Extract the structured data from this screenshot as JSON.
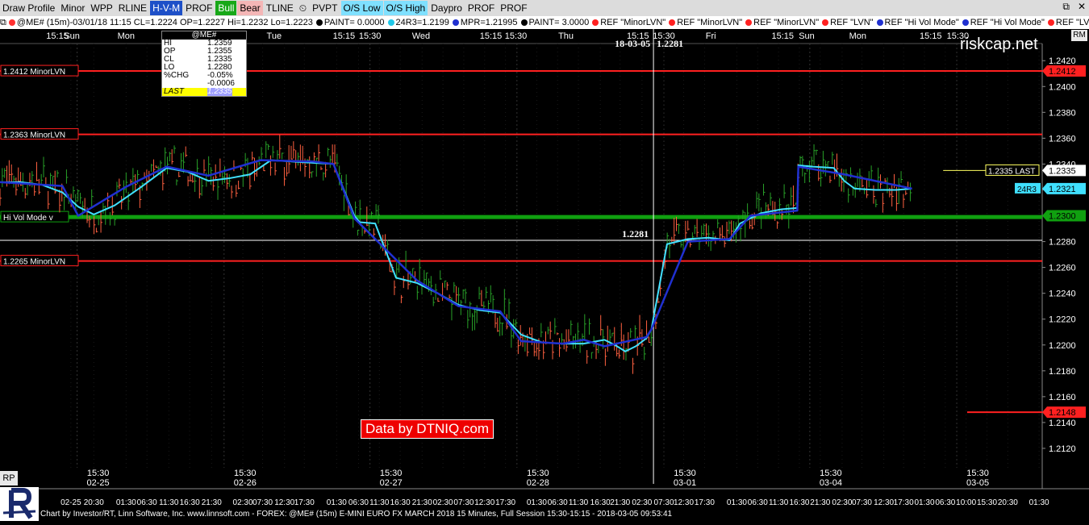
{
  "toolbar": {
    "buttons": [
      {
        "label": "Draw Profile",
        "style": ""
      },
      {
        "label": "Minor",
        "style": ""
      },
      {
        "label": "WPP",
        "style": ""
      },
      {
        "label": "RLINE",
        "style": ""
      },
      {
        "label": "H-V-M",
        "style": "blue"
      },
      {
        "label": "PROF",
        "style": ""
      },
      {
        "label": "Bull",
        "style": "green"
      },
      {
        "label": "Bear",
        "style": "pink"
      },
      {
        "label": "TLINE",
        "style": ""
      },
      {
        "label": "⏲",
        "style": ""
      },
      {
        "label": "PVPT",
        "style": ""
      },
      {
        "label": "O/S Low",
        "style": "cyan"
      },
      {
        "label": "O/S High",
        "style": "cyan"
      },
      {
        "label": "Daypro",
        "style": ""
      },
      {
        "label": "PROF",
        "style": ""
      },
      {
        "label": "PROF",
        "style": ""
      }
    ]
  },
  "window_controls": {
    "restore": "⧉",
    "close": "✕"
  },
  "study_bar": [
    {
      "text": "@ME# (15m)-03/01/18 11:15 CL=1.2224 OP=1.2227 Hi=1.2232 Lo=1.2223",
      "color": "#ff3030"
    },
    {
      "text": "PAINT= 0.0000",
      "color": "#000000"
    },
    {
      "text": "24R3=1.2199",
      "color": "#20c8e8"
    },
    {
      "text": "MPR=1.21995",
      "color": "#2030d0"
    },
    {
      "text": "PAINT= 3.0000",
      "color": "#000000"
    },
    {
      "text": "REF \"MinorLVN\"",
      "color": "#ff2020"
    },
    {
      "text": "REF \"MinorLVN\"",
      "color": "#ff2020"
    },
    {
      "text": "REF \"MinorLVN\"",
      "color": "#ff2020"
    },
    {
      "text": "REF \"LVN\"",
      "color": "#ff2020"
    },
    {
      "text": "REF \"Hi Vol Mode\"",
      "color": "#2030d0"
    },
    {
      "text": "REF \"Hi Vol Mode\"",
      "color": "#2030d0"
    },
    {
      "text": "REF \"LVN\"",
      "color": "#ff2020"
    }
  ],
  "quote": {
    "symbol": "@ME#",
    "rows": [
      {
        "label": "HI",
        "value": "1.2359"
      },
      {
        "label": "OP",
        "value": "1.2355"
      },
      {
        "label": "CL",
        "value": "1.2335"
      },
      {
        "label": "LO",
        "value": "1.2280"
      },
      {
        "label": "%CHG",
        "value": "-0.05%"
      },
      {
        "label": "",
        "value": "-0.0006"
      },
      {
        "label": "LAST",
        "value": "1.2335"
      }
    ]
  },
  "watermark": "riskcap.net",
  "data_label": "Data by DTNIQ.com",
  "footer": "Chart by Investor/RT, Linn Software, Inc. www.linnsoft.com - FOREX: @ME# (15m) E-MINI EURO FX MARCH 2018 15 Minutes, Full Session 15:30-15:15 - 2018-03-05 09:53:41",
  "rp_label": "RP",
  "rm_label": "RM",
  "chart_data": {
    "type": "line",
    "ylim": [
      1.2105,
      1.2432
    ],
    "y_ticks": [
      "1.2120",
      "1.2140",
      "1.2160",
      "1.2180",
      "1.2200",
      "1.2220",
      "1.2240",
      "1.2260",
      "1.2280",
      "1.2300",
      "1.2320",
      "1.2340",
      "1.2360",
      "1.2380",
      "1.2400",
      "1.2420"
    ],
    "top_time_labels": [
      {
        "x": 0.055,
        "t": "15:15"
      },
      {
        "x": 0.069,
        "t": "Sun"
      },
      {
        "x": 0.121,
        "t": "Mon"
      },
      {
        "x": 0.263,
        "t": "Tue"
      },
      {
        "x": 0.33,
        "t": "15:15"
      },
      {
        "x": 0.355,
        "t": "15:30"
      },
      {
        "x": 0.404,
        "t": "Wed"
      },
      {
        "x": 0.471,
        "t": "15:15"
      },
      {
        "x": 0.495,
        "t": "15:30"
      },
      {
        "x": 0.543,
        "t": "Thu"
      },
      {
        "x": 0.612,
        "t": "15:15"
      },
      {
        "x": 0.637,
        "t": "15:30"
      },
      {
        "x": 0.682,
        "t": "Fri"
      },
      {
        "x": 0.751,
        "t": "15:15"
      },
      {
        "x": 0.774,
        "t": "Sun"
      },
      {
        "x": 0.823,
        "t": "Mon"
      },
      {
        "x": 0.893,
        "t": "15:15"
      },
      {
        "x": 0.919,
        "t": "15:30"
      }
    ],
    "session_labels": [
      {
        "x": 0.074,
        "time": "15:30",
        "date": "02-25"
      },
      {
        "x": 0.215,
        "time": "15:30",
        "date": "02-26"
      },
      {
        "x": 0.355,
        "time": "15:30",
        "date": "02-27"
      },
      {
        "x": 0.496,
        "time": "15:30",
        "date": "02-28"
      },
      {
        "x": 0.637,
        "time": "15:30",
        "date": "03-01"
      },
      {
        "x": 0.777,
        "time": "15:30",
        "date": "03-04"
      },
      {
        "x": 0.918,
        "time": "15:30",
        "date": "03-05"
      }
    ],
    "bottom_time_labels": [
      {
        "x": 0.068,
        "t": "02-25"
      },
      {
        "x": 0.09,
        "t": "20:30"
      },
      {
        "x": 0.121,
        "t": "01:30"
      },
      {
        "x": 0.141,
        "t": "06:30"
      },
      {
        "x": 0.162,
        "t": "11:30"
      },
      {
        "x": 0.182,
        "t": "16:30"
      },
      {
        "x": 0.203,
        "t": "21:30"
      },
      {
        "x": 0.233,
        "t": "02:30"
      },
      {
        "x": 0.252,
        "t": "07:30"
      },
      {
        "x": 0.273,
        "t": "12:30"
      },
      {
        "x": 0.292,
        "t": "17:30"
      },
      {
        "x": 0.323,
        "t": "01:30"
      },
      {
        "x": 0.344,
        "t": "06:30"
      },
      {
        "x": 0.364,
        "t": "11:30"
      },
      {
        "x": 0.384,
        "t": "16:30"
      },
      {
        "x": 0.405,
        "t": "21:30"
      },
      {
        "x": 0.425,
        "t": "02:30"
      },
      {
        "x": 0.445,
        "t": "07:30"
      },
      {
        "x": 0.465,
        "t": "12:30"
      },
      {
        "x": 0.485,
        "t": "17:30"
      },
      {
        "x": 0.515,
        "t": "01:30"
      },
      {
        "x": 0.535,
        "t": "06:30"
      },
      {
        "x": 0.555,
        "t": "11:30"
      },
      {
        "x": 0.576,
        "t": "16:30"
      },
      {
        "x": 0.595,
        "t": "21:30"
      },
      {
        "x": 0.616,
        "t": "02:30"
      },
      {
        "x": 0.637,
        "t": "07:30"
      },
      {
        "x": 0.656,
        "t": "12:30"
      },
      {
        "x": 0.676,
        "t": "17:30"
      },
      {
        "x": 0.707,
        "t": "01:30"
      },
      {
        "x": 0.727,
        "t": "06:30"
      },
      {
        "x": 0.747,
        "t": "11:30"
      },
      {
        "x": 0.767,
        "t": "16:30"
      },
      {
        "x": 0.787,
        "t": "21:30"
      },
      {
        "x": 0.808,
        "t": "02:30"
      },
      {
        "x": 0.827,
        "t": "07:30"
      },
      {
        "x": 0.848,
        "t": "12:30"
      },
      {
        "x": 0.867,
        "t": "17:30"
      },
      {
        "x": 0.887,
        "t": "01:30"
      },
      {
        "x": 0.907,
        "t": "06:30"
      },
      {
        "x": 0.927,
        "t": "10:00"
      },
      {
        "x": 0.947,
        "t": "15:30"
      },
      {
        "x": 0.967,
        "t": "20:30"
      },
      {
        "x": 0.997,
        "t": "01:30"
      }
    ],
    "levels": [
      {
        "label": "1.2412 MinorLVN",
        "value": 1.2412,
        "color": "#ff2020"
      },
      {
        "label": "1.2363 MinorLVN",
        "value": 1.2363,
        "color": "#ff2020"
      },
      {
        "label": "1.2265 MinorLVN",
        "value": 1.2265,
        "color": "#ff2020"
      },
      {
        "label": "Hi Vol Mode v",
        "value": 1.2299,
        "color": "#10a010"
      }
    ],
    "price_tags": [
      {
        "text": "1.2412",
        "value": 1.2412,
        "bg": "#ff2020",
        "fg": "#000"
      },
      {
        "text": "1.2335",
        "value": 1.2335,
        "bg": "#ffffff",
        "fg": "#000"
      },
      {
        "text": "1.2321",
        "value": 1.2321,
        "bg": "#40e0ff",
        "fg": "#000"
      },
      {
        "text": "1.2300",
        "value": 1.23,
        "bg": "#10a010",
        "fg": "#000"
      },
      {
        "text": "1.2148",
        "value": 1.2148,
        "bg": "#ff2020",
        "fg": "#000"
      }
    ],
    "last_label": "1.2335 LAST",
    "last_value": 1.2335,
    "lvn_segment": {
      "value": 1.2148,
      "x_start": 0.928
    },
    "h_cross": 1.2281,
    "cross_label": "1.2281",
    "cross_date": "18-03-05",
    "cross_value_text": "1.2281",
    "cyan_label": "24R3",
    "series": [
      {
        "name": "24R3",
        "color": "#40e0ff",
        "x": [
          0.0,
          0.02,
          0.04,
          0.06,
          0.075,
          0.09,
          0.11,
          0.135,
          0.16,
          0.18,
          0.2,
          0.22,
          0.24,
          0.26,
          0.28,
          0.3,
          0.32,
          0.34,
          0.345,
          0.36,
          0.38,
          0.4,
          0.42,
          0.44,
          0.46,
          0.48,
          0.5,
          0.52,
          0.54,
          0.56,
          0.58,
          0.59,
          0.6,
          0.61,
          0.62,
          0.625,
          0.64,
          0.66,
          0.68,
          0.7,
          0.71,
          0.73,
          0.75,
          0.765,
          0.766,
          0.78,
          0.8,
          0.81,
          0.82,
          0.84,
          0.86,
          0.875
        ],
        "y": [
          1.2326,
          1.2326,
          1.2324,
          1.2318,
          1.2307,
          1.2301,
          1.2308,
          1.2322,
          1.2337,
          1.2334,
          1.2327,
          1.2329,
          1.2332,
          1.2343,
          1.2342,
          1.2341,
          1.234,
          1.23,
          1.2295,
          1.2294,
          1.2252,
          1.2248,
          1.224,
          1.2231,
          1.2227,
          1.2225,
          1.2208,
          1.2202,
          1.2201,
          1.2201,
          1.2204,
          1.22,
          1.2195,
          1.2199,
          1.2205,
          1.2212,
          1.2278,
          1.2282,
          1.2283,
          1.2281,
          1.2294,
          1.2302,
          1.2305,
          1.2306,
          1.2339,
          1.2338,
          1.2337,
          1.2327,
          1.2321,
          1.232,
          1.232,
          1.2321
        ]
      },
      {
        "name": "MPR",
        "color": "#2030d0",
        "x": [
          0.0,
          0.06,
          0.075,
          0.12,
          0.16,
          0.2,
          0.25,
          0.3,
          0.32,
          0.34,
          0.345,
          0.4,
          0.44,
          0.48,
          0.5,
          0.54,
          0.56,
          0.58,
          0.62,
          0.625,
          0.66,
          0.7,
          0.72,
          0.765,
          0.766,
          0.81,
          0.875
        ],
        "y": [
          1.2326,
          1.2323,
          1.23,
          1.2322,
          1.2338,
          1.2331,
          1.2343,
          1.2342,
          1.234,
          1.2298,
          1.2294,
          1.225,
          1.223,
          1.2226,
          1.2203,
          1.2201,
          1.2204,
          1.2199,
          1.2206,
          1.2212,
          1.228,
          1.2282,
          1.23,
          1.2304,
          1.2338,
          1.2332,
          1.2321
        ]
      }
    ]
  }
}
